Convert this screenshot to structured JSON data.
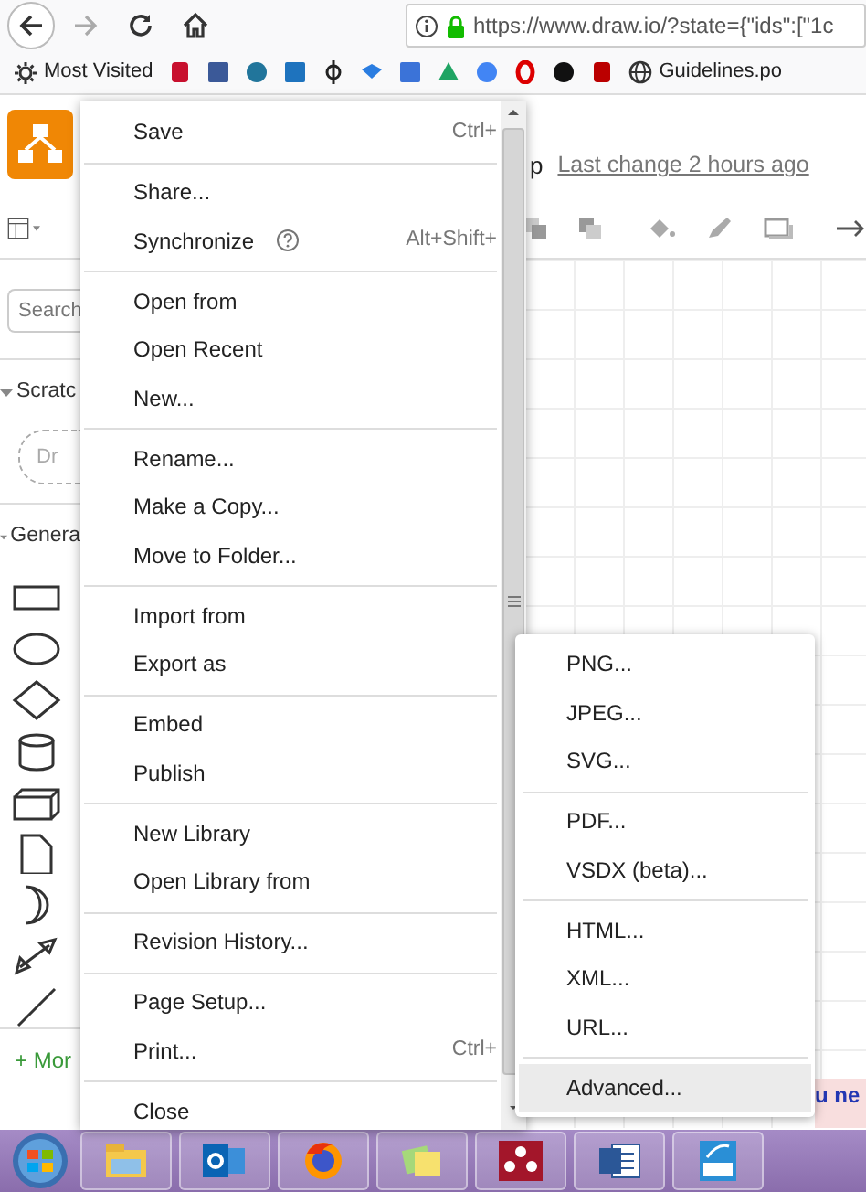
{
  "browser": {
    "url": "https://www.draw.io/?state={\"ids\":[\"1c",
    "most_visited": "Most Visited",
    "last_bookmark": "Guidelines.po"
  },
  "app": {
    "title_fragment": "p",
    "last_change": "Last change 2 hours ago",
    "search": {
      "placeholder": "Search"
    },
    "sections": [
      {
        "title": "Scratc",
        "expanded": true
      },
      {
        "title": "Genera",
        "expanded": true
      }
    ],
    "scratchpad_hint": "Dr",
    "more_shapes": "+ Mor",
    "notice": "u ne"
  },
  "file_menu": {
    "groups": [
      [
        {
          "label": "Save",
          "shortcut": "Ctrl+"
        }
      ],
      [
        {
          "label": "Share..."
        },
        {
          "label": "Synchronize",
          "help": true,
          "shortcut": "Alt+Shift+"
        }
      ],
      [
        {
          "label": "Open from"
        },
        {
          "label": "Open Recent"
        },
        {
          "label": "New..."
        }
      ],
      [
        {
          "label": "Rename..."
        },
        {
          "label": "Make a Copy..."
        },
        {
          "label": "Move to Folder..."
        }
      ],
      [
        {
          "label": "Import from"
        },
        {
          "label": "Export as",
          "submenu": [
            [
              {
                "label": "PNG...",
                "selected": false
              },
              {
                "label": "JPEG...",
                "selected": false
              },
              {
                "label": "SVG...",
                "selected": false
              }
            ],
            [
              {
                "label": "PDF...",
                "selected": false
              },
              {
                "label": "VSDX (beta)...",
                "selected": false
              }
            ],
            [
              {
                "label": "HTML...",
                "selected": false
              },
              {
                "label": "XML...",
                "selected": false
              },
              {
                "label": "URL...",
                "selected": false
              }
            ],
            [
              {
                "label": "Advanced...",
                "selected": true
              }
            ]
          ]
        }
      ],
      [
        {
          "label": "Embed"
        },
        {
          "label": "Publish"
        }
      ],
      [
        {
          "label": "New Library"
        },
        {
          "label": "Open Library from"
        }
      ],
      [
        {
          "label": "Revision History..."
        }
      ],
      [
        {
          "label": "Page Setup..."
        },
        {
          "label": "Print...",
          "shortcut": "Ctrl+"
        }
      ],
      [
        {
          "label": "Close"
        }
      ]
    ]
  }
}
